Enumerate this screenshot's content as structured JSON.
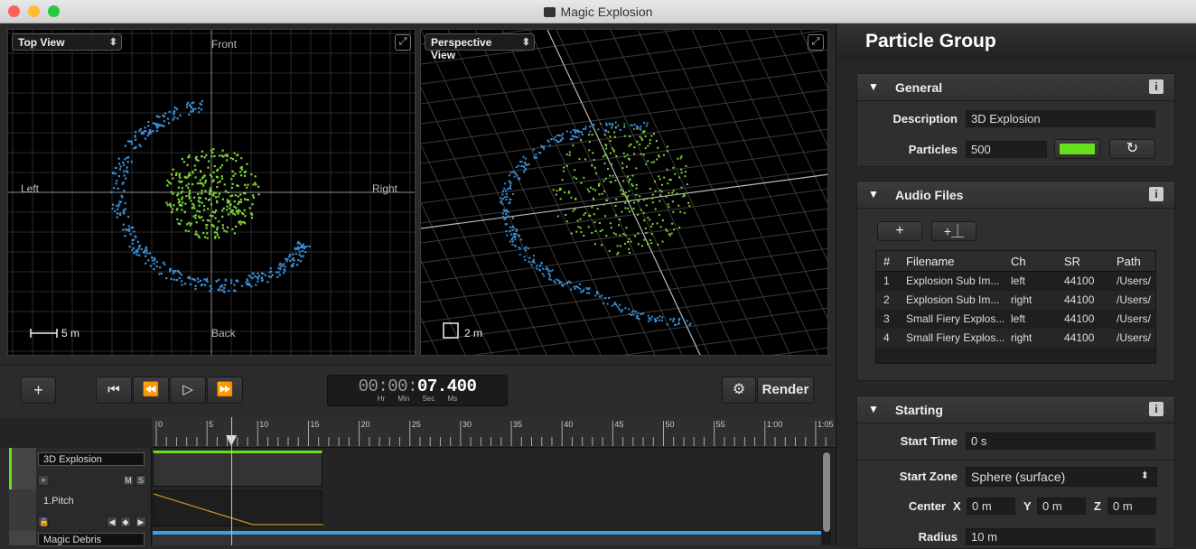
{
  "window": {
    "title": "Magic Explosion",
    "traffic_colors": {
      "close": "#fe5f57",
      "minimize": "#febc2e",
      "zoom": "#28c840"
    }
  },
  "top_view": {
    "selector": "Top View",
    "labels": {
      "front": "Front",
      "back": "Back",
      "left": "Left",
      "right": "Right"
    },
    "scale": "5 m"
  },
  "perspective_view": {
    "selector": "Perspective View",
    "scale": "2 m"
  },
  "colors": {
    "inner_particles": "#7dd63a",
    "outer_particles": "#3a8fd6",
    "accent_green": "#66e01c"
  },
  "transport": {
    "timecode_dim": "00:00:",
    "timecode_bright": "07.400",
    "units": [
      "Hr",
      "Min",
      "Sec",
      "Ms"
    ],
    "render_label": "Render"
  },
  "timeline": {
    "ticks": [
      "0",
      "5",
      "10",
      "15",
      "20",
      "25",
      "30",
      "35",
      "40",
      "45",
      "50",
      "55",
      "1:00",
      "1:05"
    ],
    "playhead_seconds": 7.4,
    "tracks": [
      {
        "name": "3D Explosion",
        "m": "M",
        "s": "S"
      },
      {
        "name": "1.Pitch"
      },
      {
        "name": "Magic Debris"
      }
    ]
  },
  "panel": {
    "title": "Particle Group",
    "general": {
      "header": "General",
      "description_label": "Description",
      "description_value": "3D Explosion",
      "particles_label": "Particles",
      "particles_value": "500"
    },
    "audio": {
      "header": "Audio Files",
      "columns": [
        "#",
        "Filename",
        "Ch",
        "SR",
        "Path"
      ],
      "rows": [
        [
          "1",
          "Explosion Sub Im...",
          "left",
          "44100",
          "/Users/"
        ],
        [
          "2",
          "Explosion Sub Im...",
          "right",
          "44100",
          "/Users/"
        ],
        [
          "3",
          "Small Fiery Explos...",
          "left",
          "44100",
          "/Users/"
        ],
        [
          "4",
          "Small Fiery Explos...",
          "right",
          "44100",
          "/Users/"
        ]
      ]
    },
    "starting": {
      "header": "Starting",
      "start_time_label": "Start Time",
      "start_time_value": "0 s",
      "start_zone_label": "Start Zone",
      "start_zone_value": "Sphere (surface)",
      "center_label": "Center",
      "x_label": "X",
      "x_value": "0 m",
      "y_label": "Y",
      "y_value": "0 m",
      "z_label": "Z",
      "z_value": "0 m",
      "radius_label": "Radius",
      "radius_value": "10 m"
    }
  }
}
